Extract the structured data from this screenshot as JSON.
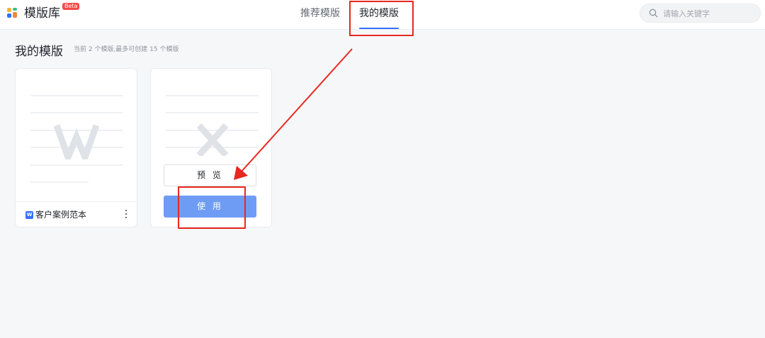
{
  "header": {
    "app_title": "模版库",
    "beta_badge": "Beta",
    "tabs": [
      {
        "label": "推荐模版",
        "active": false
      },
      {
        "label": "我的模版",
        "active": true
      }
    ],
    "search": {
      "placeholder": "请输入关键字",
      "value": ""
    }
  },
  "section": {
    "title": "我的模版",
    "subtitle": "当前 2 个模版,最多可创建 15 个模版"
  },
  "cards": [
    {
      "name": "客户案例范本",
      "thumb_letter": "W",
      "doc_icon": "word-doc-icon",
      "doc_icon_glyph": "W"
    },
    {
      "name": "",
      "thumb_letter": "X",
      "hover": true,
      "preview_label": "预 览",
      "use_label": "使 用"
    }
  ],
  "colors": {
    "accent": "#3370ff",
    "use_button": "#6e9cf5",
    "annotation_red": "#e8271f",
    "beta_red": "#f54a45"
  }
}
